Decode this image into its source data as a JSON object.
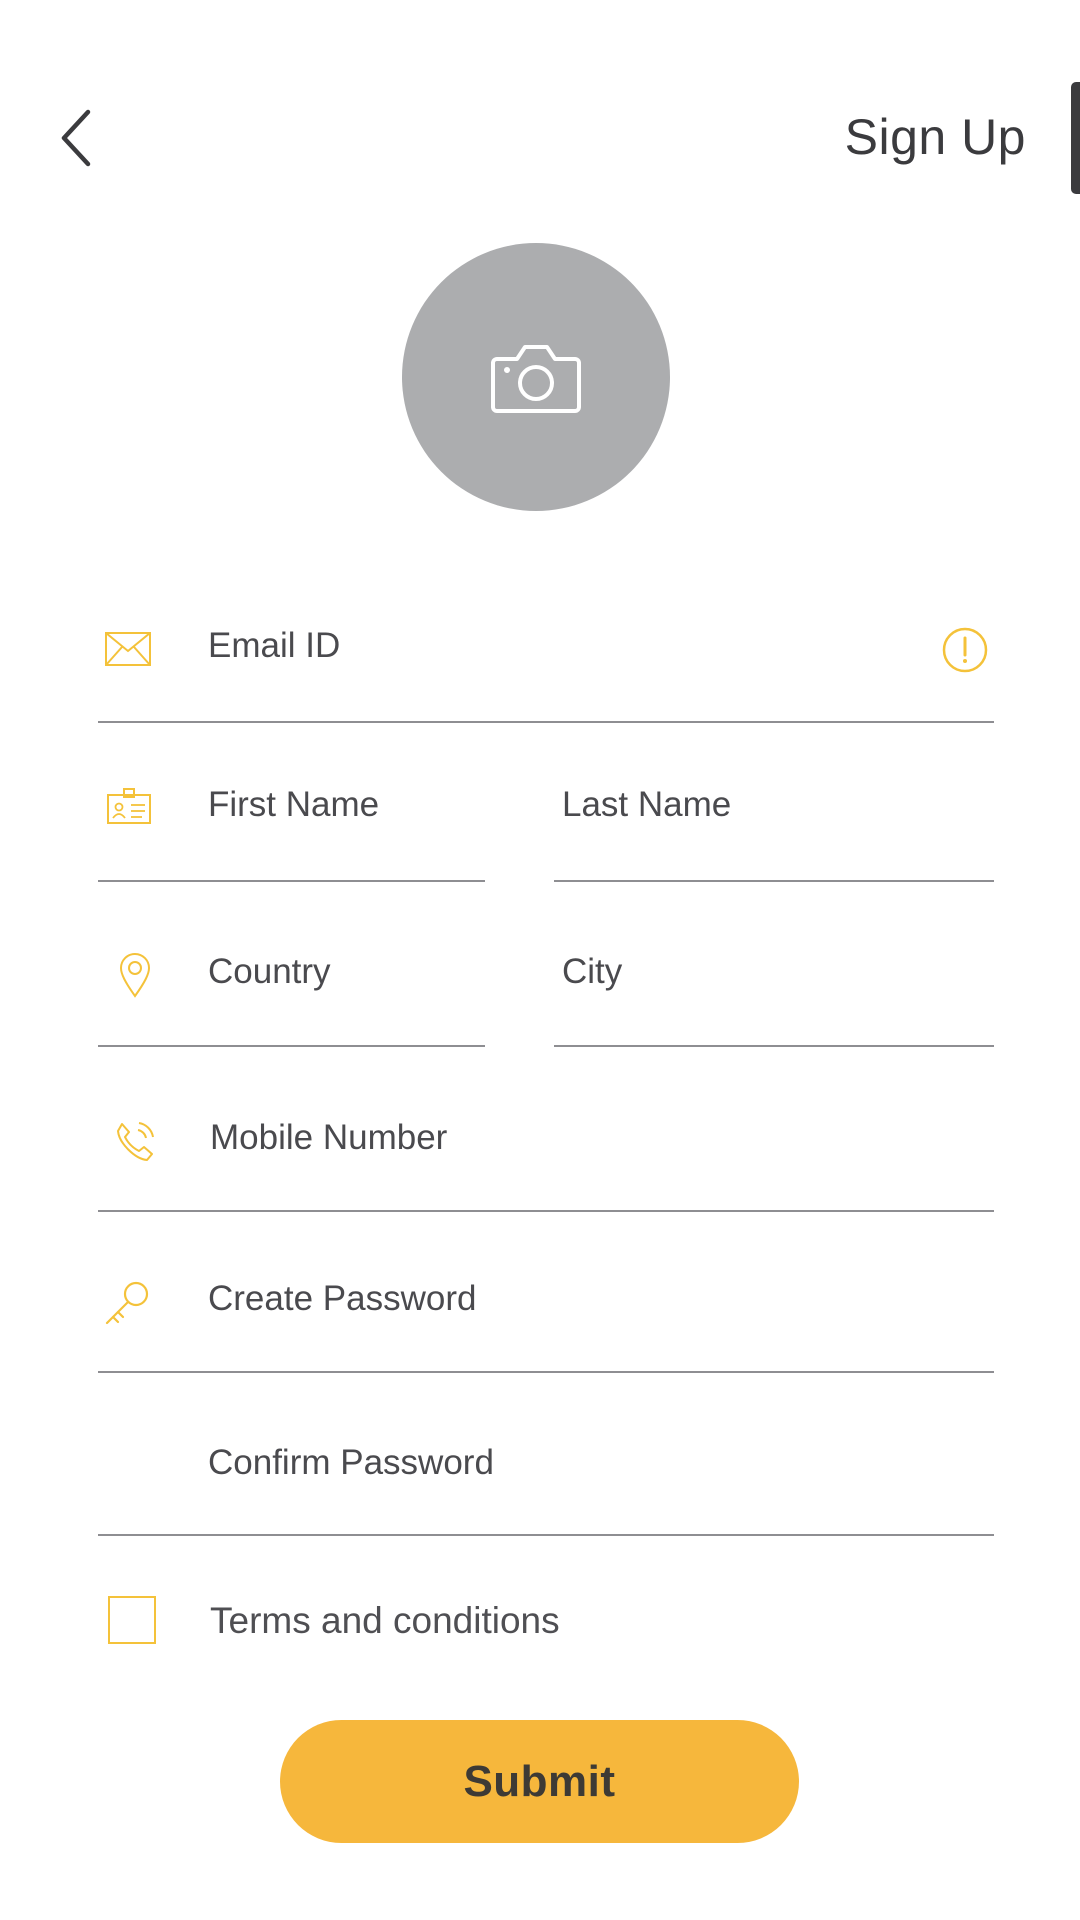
{
  "header": {
    "title": "Sign Up"
  },
  "avatar": {
    "icon": "camera-icon"
  },
  "fields": {
    "email": {
      "placeholder": "Email ID",
      "icon": "envelope-icon",
      "status_icon": "alert-circle-icon"
    },
    "first_name": {
      "placeholder": "First Name",
      "icon": "id-card-icon"
    },
    "last_name": {
      "placeholder": "Last Name"
    },
    "country": {
      "placeholder": "Country",
      "icon": "location-pin-icon"
    },
    "city": {
      "placeholder": "City"
    },
    "mobile": {
      "placeholder": "Mobile Number",
      "icon": "phone-icon"
    },
    "password": {
      "placeholder": "Create Password",
      "icon": "key-icon"
    },
    "confirm_password": {
      "placeholder": "Confirm Password"
    }
  },
  "terms": {
    "label": "Terms and conditions",
    "checked": false
  },
  "submit": {
    "label": "Submit"
  },
  "colors": {
    "accent": "#f6b73c",
    "icon_yellow": "#f4c23a",
    "avatar_gray": "#acadaf",
    "text_dark": "#3b3b3e",
    "divider": "#8e8e92"
  }
}
